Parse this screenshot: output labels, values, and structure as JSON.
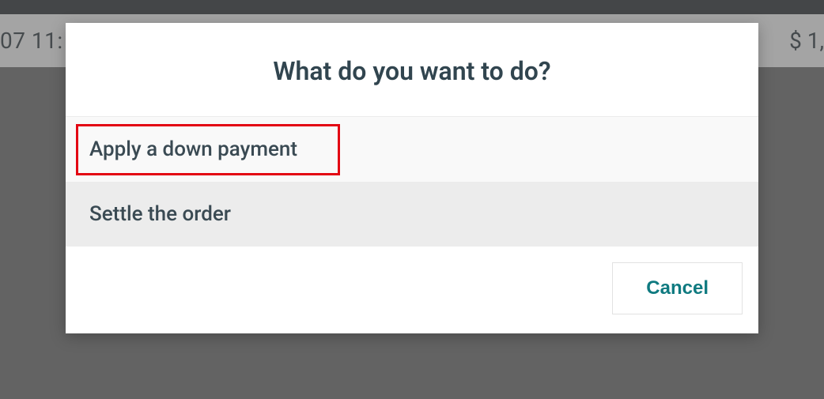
{
  "background": {
    "time_fragment": "07 11:",
    "amount_fragment": "$ 1,"
  },
  "modal": {
    "title": "What do you want to do?",
    "options": [
      {
        "label": "Apply a down payment"
      },
      {
        "label": "Settle the order"
      }
    ],
    "cancel_label": "Cancel"
  }
}
